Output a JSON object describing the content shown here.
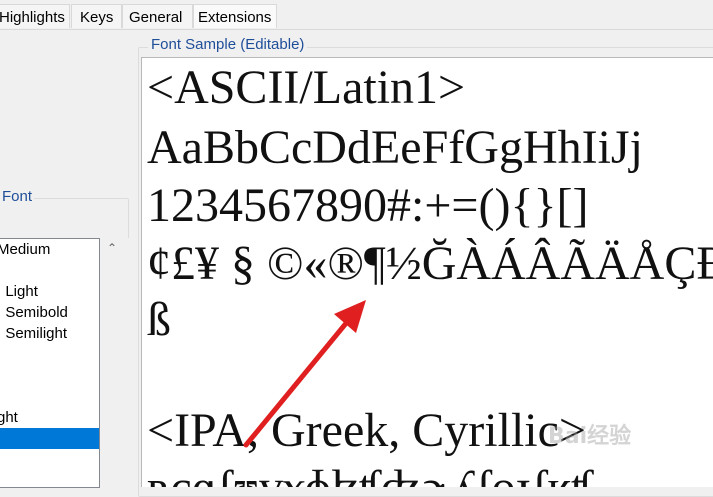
{
  "tabs": [
    {
      "label": "Highlights"
    },
    {
      "label": "Keys"
    },
    {
      "label": "General"
    },
    {
      "label": "Extensions"
    }
  ],
  "font_group": {
    "title": "Font",
    "items": [
      {
        "label": "Medium"
      },
      {
        "label": "I"
      },
      {
        "label": "I Light"
      },
      {
        "label": "I Semibold"
      },
      {
        "label": "I Semilight"
      },
      {
        "label": ""
      },
      {
        "label": ""
      },
      {
        "label": ""
      },
      {
        "label": "ght"
      },
      {
        "label": "",
        "selected": true
      }
    ]
  },
  "sample": {
    "title": "Font Sample (Editable)",
    "lines": [
      "<ASCII/Latin1>",
      "AaBbCcDdEeFfGgHhIiJj",
      "1234567890#:+=(){}[]",
      "¢£¥ § ©«®¶½ĞÀÁÂÃÄÅÇĐ(",
      "ß",
      "",
      "<IPA, Greek, Cyrillic>",
      "ʀçɑʃʊɣɤɸɮʧʤɚʎʃɵɟʃʁʧ"
    ]
  },
  "watermark": "Bai经验",
  "colors": {
    "group_title": "#1f4e99",
    "selection": "#0078d7",
    "arrow": "#e02020"
  }
}
